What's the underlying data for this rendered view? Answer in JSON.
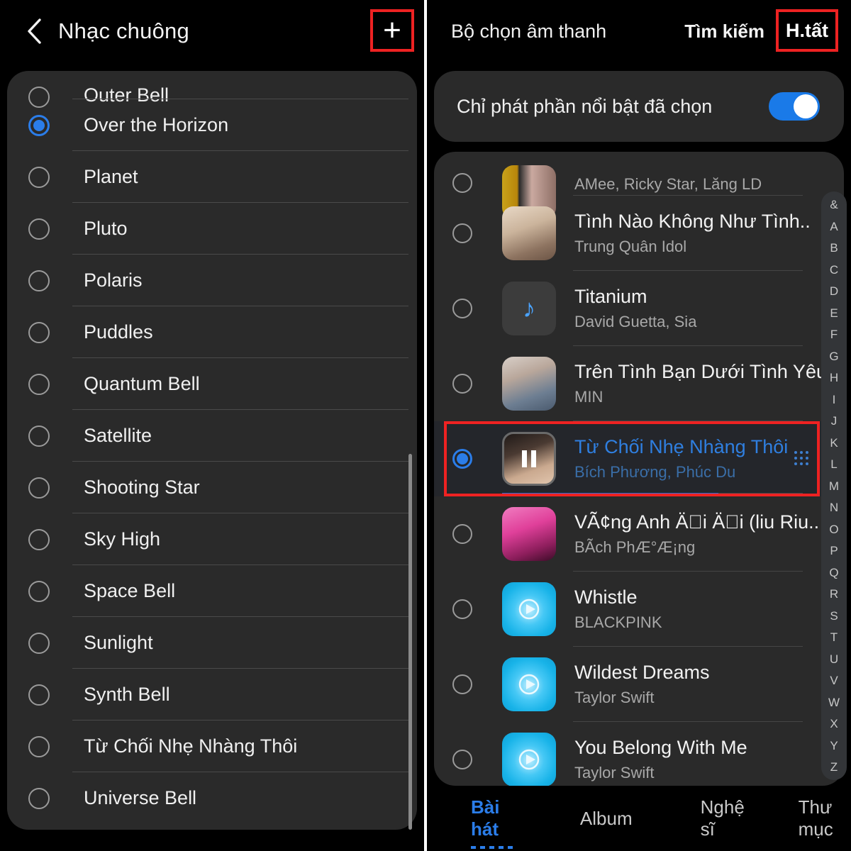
{
  "left_panel": {
    "header": {
      "back_icon": "chevron-left-icon",
      "title": "Nhạc chuông",
      "add_icon": "plus-icon",
      "add_highlight_color": "#ee2222"
    },
    "ringtones": [
      {
        "label": "Outer Bell",
        "selected": false,
        "clipped": true
      },
      {
        "label": "Over the Horizon",
        "selected": true,
        "clipped": false
      },
      {
        "label": "Planet",
        "selected": false,
        "clipped": false
      },
      {
        "label": "Pluto",
        "selected": false,
        "clipped": false
      },
      {
        "label": "Polaris",
        "selected": false,
        "clipped": false
      },
      {
        "label": "Puddles",
        "selected": false,
        "clipped": false
      },
      {
        "label": "Quantum Bell",
        "selected": false,
        "clipped": false
      },
      {
        "label": "Satellite",
        "selected": false,
        "clipped": false
      },
      {
        "label": "Shooting Star",
        "selected": false,
        "clipped": false
      },
      {
        "label": "Sky High",
        "selected": false,
        "clipped": false
      },
      {
        "label": "Space Bell",
        "selected": false,
        "clipped": false
      },
      {
        "label": "Sunlight",
        "selected": false,
        "clipped": false
      },
      {
        "label": "Synth Bell",
        "selected": false,
        "clipped": false
      },
      {
        "label": "Từ Chối Nhẹ Nhàng Thôi",
        "selected": false,
        "clipped": false
      },
      {
        "label": "Universe Bell",
        "selected": false,
        "clipped": false
      }
    ]
  },
  "right_panel": {
    "header": {
      "title": "Bộ chọn âm thanh",
      "search_label": "Tìm kiếm",
      "all_label": "H.tất",
      "all_highlight_color": "#ee2222"
    },
    "toggle_row": {
      "label": "Chỉ phát phần nổi bật đã chọn",
      "state": "on",
      "accent": "#1a7ae8"
    },
    "songs": [
      {
        "title": "",
        "artist": "AMee, Ricky Star, Lăng LD",
        "art": "amee",
        "selected": false,
        "clipped": true
      },
      {
        "title": "Tình Nào Không Như Tình..",
        "artist": "Trung Quân Idol",
        "art": "tinh",
        "selected": false,
        "clipped": false
      },
      {
        "title": "Titanium",
        "artist": "David Guetta, Sia",
        "art": "note",
        "selected": false,
        "clipped": false
      },
      {
        "title": "Trên Tình Bạn Dưới Tình Yêu",
        "artist": "MIN",
        "art": "min",
        "selected": false,
        "clipped": false
      },
      {
        "title": "Từ Chối Nhẹ Nhàng Thôi",
        "artist": "Bích Phương, Phúc Du",
        "art": "tuchoi",
        "selected": true,
        "clipped": false
      },
      {
        "title": "VÃ¢ng Anh Ä\u0000i Ä\u0000i (liu Riu..",
        "artist": "BÃ­ch PhÆ°Æ¡ng",
        "art": "vang",
        "selected": false,
        "clipped": false
      },
      {
        "title": "Whistle",
        "artist": "BLACKPINK",
        "art": "blue",
        "selected": false,
        "clipped": false
      },
      {
        "title": "Wildest Dreams",
        "artist": "Taylor Swift",
        "art": "blue",
        "selected": false,
        "clipped": false
      },
      {
        "title": "You Belong With Me",
        "artist": "Taylor Swift",
        "art": "blue",
        "selected": false,
        "clipped": false
      }
    ],
    "alpha_index": [
      "&",
      "A",
      "B",
      "C",
      "D",
      "E",
      "F",
      "G",
      "H",
      "I",
      "J",
      "K",
      "L",
      "M",
      "N",
      "O",
      "P",
      "Q",
      "R",
      "S",
      "T",
      "U",
      "V",
      "W",
      "X",
      "Y",
      "Z"
    ],
    "tabs": [
      {
        "label": "Bài hát",
        "active": true
      },
      {
        "label": "Album",
        "active": false
      },
      {
        "label": "Nghệ sĩ",
        "active": false
      },
      {
        "label": "Thư mục",
        "active": false
      }
    ],
    "progress_percent": 72
  }
}
